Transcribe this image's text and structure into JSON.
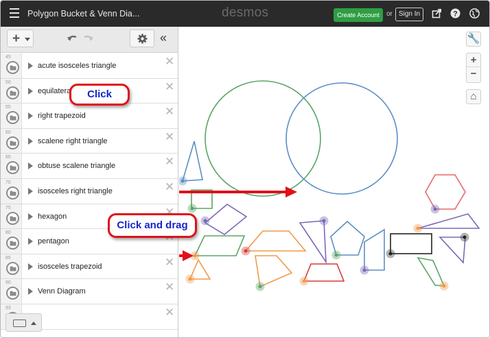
{
  "header": {
    "title": "Polygon Bucket & Venn Dia...",
    "logo": "desmos",
    "create_account": "Create Account",
    "or": "or",
    "sign_in": "Sign In"
  },
  "expressions": [
    {
      "num": "45",
      "label": "acute isosceles triangle"
    },
    {
      "num": "50",
      "label": "equilateral"
    },
    {
      "num": "55",
      "label": "right trapezoid"
    },
    {
      "num": "60",
      "label": "scalene right triangle"
    },
    {
      "num": "65",
      "label": "obtuse scalene triangle"
    },
    {
      "num": "70",
      "label": "isosceles right triangle"
    },
    {
      "num": "75",
      "label": "hexagon"
    },
    {
      "num": "80",
      "label": "pentagon"
    },
    {
      "num": "85",
      "label": "isosceles trapezoid"
    },
    {
      "num": "90",
      "label": "Venn Diagram"
    },
    {
      "num": "93",
      "label": ""
    }
  ],
  "annotations": {
    "click": "Click",
    "click_and_drag": "Click and drag"
  },
  "colors": {
    "green": "#5aa566",
    "blue": "#5b8ec4",
    "purple": "#7b68b8",
    "orange": "#ef9a4a",
    "red": "#d63b3b",
    "black": "#222222",
    "callout_border": "#e0101a",
    "callout_text": "#1725c8"
  },
  "icons": [
    "menu-icon",
    "share-icon",
    "help-icon",
    "globe-icon",
    "wrench-icon",
    "zoom-in-icon",
    "zoom-out-icon",
    "home-icon",
    "undo-icon",
    "redo-icon",
    "gear-icon",
    "collapse-icon",
    "keyboard-icon",
    "folder-icon",
    "delete-icon"
  ]
}
